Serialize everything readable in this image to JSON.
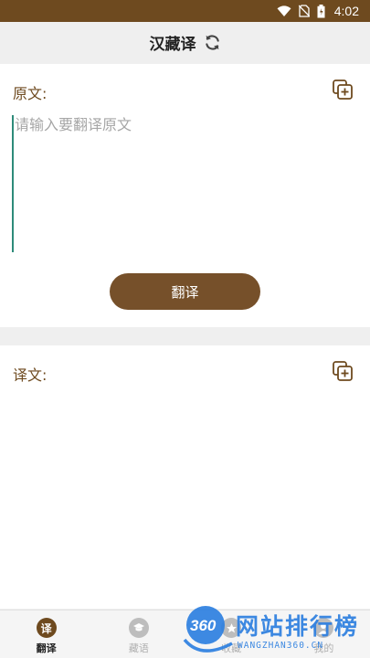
{
  "status_bar": {
    "time": "4:02"
  },
  "header": {
    "title": "汉藏译",
    "switch_icon": "refresh-icon"
  },
  "source": {
    "label": "原文:",
    "placeholder": "请输入要翻译原文",
    "value": "",
    "translate_button": "翻译",
    "copy_icon": "copy-icon"
  },
  "target": {
    "label": "译文:",
    "copy_icon": "copy-icon"
  },
  "tabs": [
    {
      "label": "翻译",
      "icon_text": "译",
      "active": true
    },
    {
      "label": "藏语",
      "icon": "graduation-cap-icon",
      "active": false
    },
    {
      "label": "收藏",
      "icon": "star-icon",
      "active": false
    },
    {
      "label": "我的",
      "icon": "user-icon",
      "active": false
    }
  ],
  "watermark": {
    "logo": "360",
    "main": "网站排行榜",
    "sub": "WANGZHAN360.CN"
  },
  "colors": {
    "brand": "#76502a",
    "status_bar": "#6e4a1f",
    "label": "#6e4a1f",
    "cursor": "#2e8b7a",
    "watermark": "#2d7fe0"
  }
}
